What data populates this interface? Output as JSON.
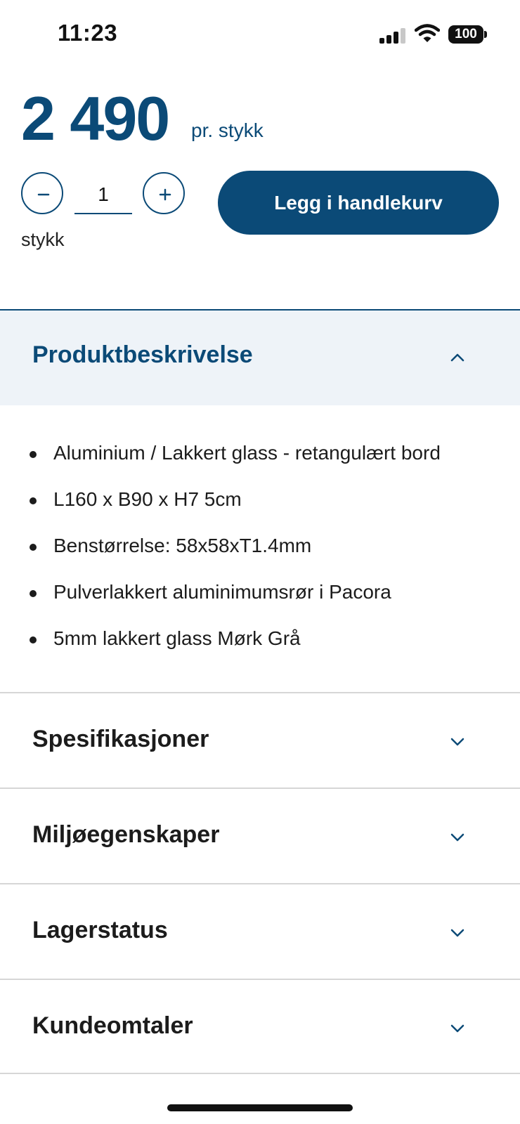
{
  "status_bar": {
    "time": "11:23",
    "battery": "100"
  },
  "product": {
    "price": "2 490",
    "price_unit": "pr. stykk",
    "quantity": "1",
    "quantity_unit": "stykk",
    "add_to_cart_label": "Legg i handlekurv"
  },
  "accordion": {
    "open_section": {
      "title": "Produktbeskrivelse",
      "bullets": [
        "Aluminium / Lakkert glass - retangulært bord",
        "L160 x B90 x H7 5cm",
        "Benstørrelse: 58x58xT1.4mm",
        "Pulverlakkert aluminimumsrør i Pacora",
        "5mm lakkert glass Mørk Grå"
      ]
    },
    "closed_sections": [
      {
        "title": "Spesifikasjoner"
      },
      {
        "title": "Miljøegenskaper"
      },
      {
        "title": "Lagerstatus"
      },
      {
        "title": "Kundeomtaler"
      }
    ]
  },
  "colors": {
    "brand": "#0b4a77",
    "open_section_bg": "#eef3f8",
    "divider": "#d6d6d6"
  }
}
